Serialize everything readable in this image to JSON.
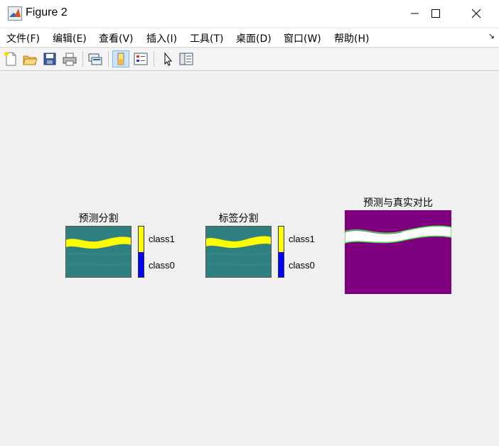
{
  "window": {
    "title": "Figure 2"
  },
  "menu": [
    "文件(F)",
    "编辑(E)",
    "查看(V)",
    "插入(I)",
    "工具(T)",
    "桌面(D)",
    "窗口(W)",
    "帮助(H)"
  ],
  "toolbar": {
    "icons": [
      "new-figure-icon",
      "open-file-icon",
      "save-icon",
      "print-icon",
      "link-plot-icon",
      "colorbar-icon",
      "legend-icon",
      "pointer-icon",
      "property-inspector-icon"
    ],
    "active": "colorbar-icon"
  },
  "axes": {
    "pred": {
      "title": "预测分割"
    },
    "label": {
      "title": "标签分割"
    },
    "compare": {
      "title": "预测与真实对比"
    }
  },
  "colorbar": {
    "top_label": "class1",
    "bottom_label": "class0",
    "top_color": "#ffff00",
    "bottom_color": "#0000ff"
  },
  "colors": {
    "background": "#2f8080",
    "band": "#ffff00",
    "compare_bg": "#7f007f",
    "compare_band": "#ffffff",
    "compare_edge": "#44dd44"
  }
}
